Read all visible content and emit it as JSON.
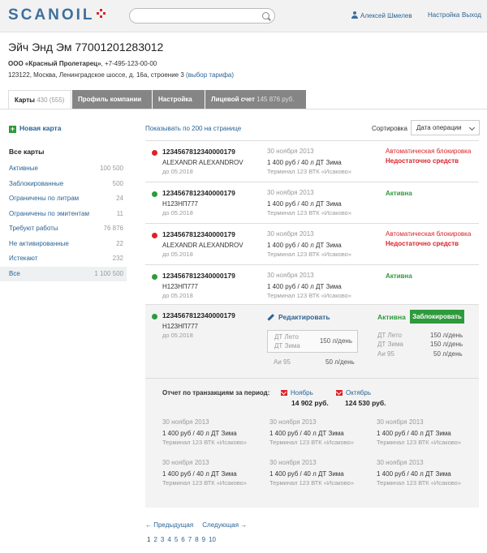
{
  "header": {
    "logo": "SCANOIL",
    "user": "Алексей Шмелев",
    "settings": "Настройка",
    "logout": "Выход"
  },
  "company": {
    "title": "Эйч Энд Эм 77001201283012",
    "name": "ООО «Красный Пролетарец»",
    "phone": ", +7-495-123-00-00",
    "address": "123122, Москва, Ленинградское шоссе, д. 16а, строение 3",
    "tariff": "(выбор тарифа)"
  },
  "tabs": [
    {
      "label": "Карты",
      "count": "430 (555)"
    },
    {
      "label": "Профиль компании",
      "count": ""
    },
    {
      "label": "Настройка",
      "count": ""
    },
    {
      "label": "Лицевой счет",
      "count": "145 876 руб."
    }
  ],
  "sidebar": {
    "new_card": "Новая карта",
    "all_cards": "Все карты",
    "filters": [
      {
        "label": "Активные",
        "count": "100 500"
      },
      {
        "label": "Заблокированные",
        "count": "500"
      },
      {
        "label": "Ограничены по литрам",
        "count": "24"
      },
      {
        "label": "Ограничены по эмитентам",
        "count": "11"
      },
      {
        "label": "Требуют работы",
        "count": "76 876"
      },
      {
        "label": "Не активированные",
        "count": "22"
      },
      {
        "label": "Истекают",
        "count": "232"
      },
      {
        "label": "Все",
        "count": "1 100 500"
      }
    ]
  },
  "list": {
    "show_per_page": "Показывать по 200 на странице",
    "sort_label": "Сортировка",
    "sort_value": "Дата операции",
    "rows": [
      {
        "number": "1234567812340000179",
        "name": "ALEXANDR ALEXANDROV",
        "expires": "до 05.2018",
        "date": "30 ноября 2013",
        "amount": "1 400 руб / 40 л ДТ Зима",
        "terminal": "Терминал 123 ВТК «Исаково»",
        "status1": "Автоматическая блокировка",
        "status2": "Недостаточно средств",
        "state": "red"
      },
      {
        "number": "1234567812340000179",
        "name": "Н123НП777",
        "expires": "до 05.2018",
        "date": "30 ноября 2013",
        "amount": "1 400 руб / 40 л ДТ Зима",
        "terminal": "Терминал 123 ВТК «Исаково»",
        "status1": "Активна",
        "status2": "",
        "state": "green"
      },
      {
        "number": "1234567812340000179",
        "name": "ALEXANDR ALEXANDROV",
        "expires": "до 05.2018",
        "date": "30 ноября 2013",
        "amount": "1 400 руб / 40 л ДТ Зима",
        "terminal": "Терминал 123 ВТК «Исаково»",
        "status1": "Автоматическая блокировка",
        "status2": "Недостаточно средств",
        "state": "red"
      },
      {
        "number": "1234567812340000179",
        "name": "Н123НП777",
        "expires": "до 05.2018",
        "date": "30 ноября 2013",
        "amount": "1 400 руб / 40 л ДТ Зима",
        "terminal": "Терминал 123 ВТК «Исаково»",
        "status1": "Активна",
        "status2": "",
        "state": "green"
      }
    ]
  },
  "expanded": {
    "number": "1234567812340000179",
    "name": "Н123НП777",
    "expires": "до 05.2018",
    "edit": "Редактировать",
    "status": "Активна",
    "block_button": "Заблокировать",
    "limits_left": [
      {
        "fuel": "ДТ Лето",
        "limit": "150 л/день"
      },
      {
        "fuel": "ДТ Зима",
        "limit": ""
      },
      {
        "fuel": "Аи 95",
        "limit": "50 л/день"
      }
    ],
    "limits_right": [
      {
        "fuel": "ДТ Лето",
        "limit": "150 л/день"
      },
      {
        "fuel": "ДТ Зима",
        "limit": "150 л/день"
      },
      {
        "fuel": "Аи 95",
        "limit": "50 л/день"
      }
    ],
    "report_label": "Отчет по транзакциям за период:",
    "months": [
      {
        "name": "Ноябрь",
        "sum": "14 902 руб."
      },
      {
        "name": "Октябрь",
        "sum": "124 530 руб."
      }
    ],
    "transactions": [
      {
        "date": "30 ноября 2013",
        "amount": "1 400 руб / 40 л ДТ Зима",
        "terminal": "Терминал 123 ВТК «Исаково»"
      },
      {
        "date": "30 ноября 2013",
        "amount": "1 400 руб / 40 л ДТ Зима",
        "terminal": "Терминал 123 ВТК «Исаково»"
      },
      {
        "date": "30 ноября 2013",
        "amount": "1 400 руб / 40 л ДТ Зима",
        "terminal": "Терминал 123 ВТК «Исаково»"
      },
      {
        "date": "30 ноября 2013",
        "amount": "1 400 руб / 40 л ДТ Зима",
        "terminal": "Терминал 123 ВТК «Исаково»"
      },
      {
        "date": "30 ноября 2013",
        "amount": "1 400 руб / 40 л ДТ Зима",
        "terminal": "Терминал 123 ВТК «Исаково»"
      },
      {
        "date": "30 ноября 2013",
        "amount": "1 400 руб / 40 л ДТ Зима",
        "terminal": "Терминал 123 ВТК «Исаково»"
      }
    ]
  },
  "pagination": {
    "prev": "← Предыдущая",
    "next": "Следующая →",
    "pages": [
      "1",
      "2",
      "3",
      "4",
      "5",
      "6",
      "7",
      "8",
      "9",
      "10"
    ]
  },
  "colors": {
    "brand": "#3d6f9e",
    "accent_red": "#d9232a",
    "status_green": "#2e9a3c",
    "link": "#2a6496"
  }
}
